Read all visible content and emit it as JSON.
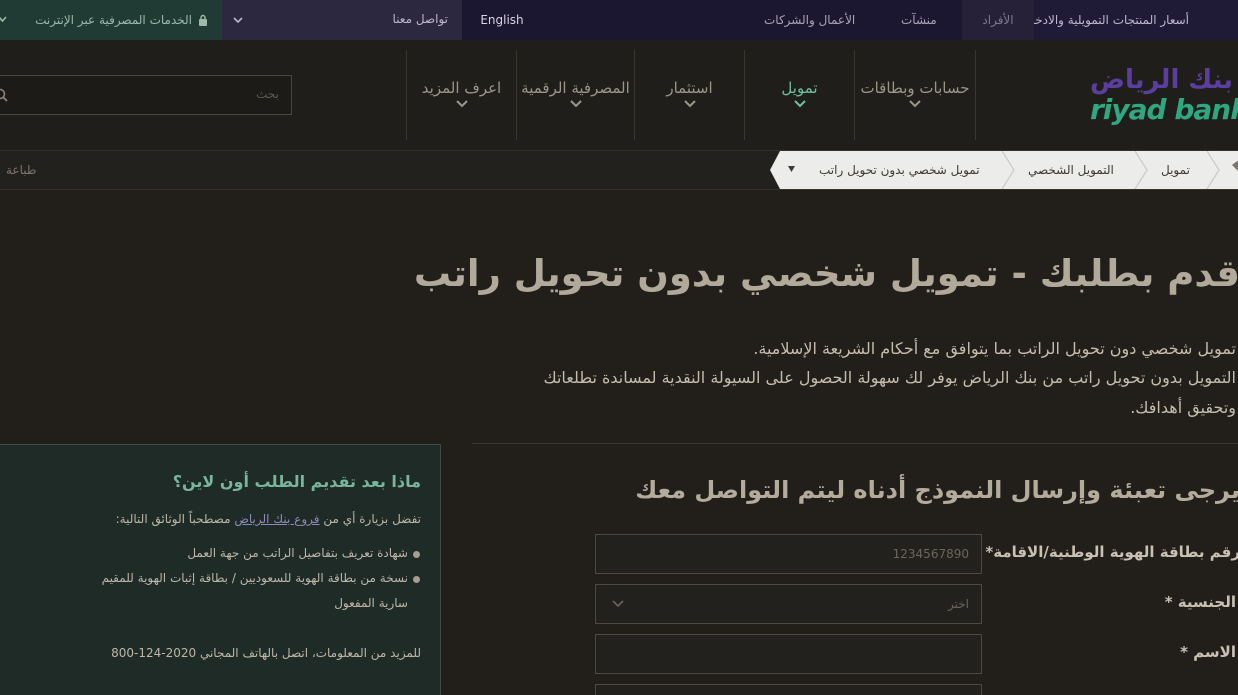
{
  "topbar": {
    "ebanking": "الخدمات المصرفية عبر الإنترنت",
    "contact": "تواصل معنا",
    "language": "English",
    "business": "الأعمال والشركات",
    "sme": "منشآت",
    "individuals": "الأفراد",
    "rates": "أسعار المنتجات التمويلية والادخارية"
  },
  "header": {
    "search_placeholder": "بحث",
    "nav": [
      {
        "label": "اعرف المزيد"
      },
      {
        "label": "المصرفية الرقمية"
      },
      {
        "label": "استثمار"
      },
      {
        "label": "تمويل"
      },
      {
        "label": "حسابات وبطاقات"
      }
    ],
    "logo_ar": "بنك الرياض",
    "logo_en": "riyad bank"
  },
  "breadcrumb": {
    "print": "طباعة",
    "items": [
      "تمويل",
      "التمويل الشخصي",
      "تمويل شخصي بدون تحويل راتب"
    ]
  },
  "page": {
    "title": "قدم بطلبك - تمويل شخصي بدون تحويل راتب",
    "paragraph_lines": [
      "تمويل شخصي دون تحويل الراتب بما يتوافق مع أحكام الشريعة الإسلامية.",
      "التمويل بدون تحويل راتب من بنك الرياض يوفر لك سهولة الحصول على السيولة النقدية لمساندة تطلعاتك",
      "وتحقيق أهدافك."
    ]
  },
  "form": {
    "heading": "يرجى تعبئة وإرسال النموذج أدناه ليتم التواصل معك",
    "id_label": "رقم بطاقة الهوية الوطنية/الاقامة*",
    "id_value": "1234567890",
    "nationality_label": "الجنسية *",
    "nationality_value": "اختر",
    "name_label": "الاسم *"
  },
  "sidebar": {
    "title": "ماذا بعد تقديم الطلب أون لاين؟",
    "intro_before": "تفضل بزيارة أي من",
    "intro_link": "فروع بنك الرياض",
    "intro_after": "مصطحباً الوثائق التالية:",
    "bullet1": "شهادة تعريف بتفاصيل الراتب من جهة العمل",
    "bullet2": "نسخة من بطاقة الهوية للسعوديين / بطاقة إثبات الهوية للمقيم",
    "bullet2_cont": "سارية المفعول",
    "contact_line": "للمزيد من المعلومات، اتصل بالهاتف المجاني 2020-124-800"
  },
  "colors": {
    "accent_green": "#6fbfa2",
    "brand_purple": "#5b3fa0",
    "background": "#221f1b"
  }
}
